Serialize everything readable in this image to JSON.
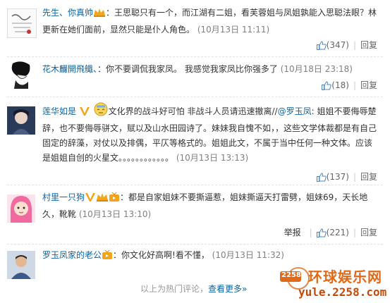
{
  "comments": [
    {
      "user": "先生、你真帅",
      "text": "：王思聪只有一个，而江湖有二姐，看芙蓉姐与凤姐孰能入思聪法眼？林更新在她们面前，显然只能是仆人角色。",
      "time": "(10月13日 11:11)",
      "likes": "(347)",
      "reply": "回复"
    },
    {
      "user": "花木麣開飛艥、",
      "text": "：你不要调侃我家凤。 我感觉我家凤比你强多了",
      "time": "(10月18日 23:18)",
      "likes": "(18)",
      "reply": "回复"
    },
    {
      "user": "莲华如是",
      "text_a": "文化界的战斗好可怕 非战斗人员请迅速撤离//",
      "mention": "@罗玉凤",
      "text_b": ": 姐姐不要侮辱楚辞，也不要侮辱骈文，赋以及山水田园诗了。妹妹我自愧不如，，这些文学体裁都是有自己固定的辞藻，对仗以及排偶，平仄等格式的。姐姐此文，不属于当中任何一种文体。应该是姐姐自创的火星文。。。。。。。。。。。。",
      "time": "(10月13日 13:13)",
      "likes": "(137)",
      "reply": "回复"
    },
    {
      "user": "村里一只狗",
      "text": "：都是自家姐妹不要撕逼惹，姐妹撕逼天打雷劈，姐妹69，天长地久，靴靴",
      "time": "(10月13日 13:10)",
      "report": "举报",
      "likes": "(221)",
      "reply": "回复"
    },
    {
      "user": "罗玉凤家的老公",
      "text": "：你文化好高啊!看不懂，",
      "time": "(10月13日 11:32)"
    }
  ],
  "footer": {
    "prefix": "以上为热门评论，",
    "more": "查看更多»"
  },
  "watermark": {
    "badge": "2258",
    "title": "环球娱乐网",
    "url": "yule.2258.com"
  },
  "colors": {
    "link": "#0a64a4",
    "time": "#808080",
    "watermark": "#e06a1a"
  }
}
